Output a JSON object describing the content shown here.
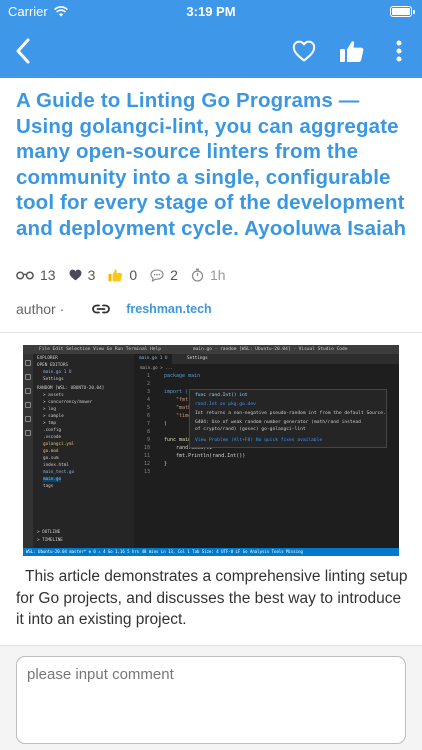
{
  "status_bar": {
    "carrier": "Carrier",
    "time": "3:19 PM"
  },
  "nav": {
    "icons": [
      "chevron-left-icon",
      "heart-outline-icon",
      "thumbs-up-icon",
      "vertical-dots-icon"
    ],
    "background": "#3f97e9"
  },
  "article": {
    "title": "A Guide to Linting Go Programs — Using golangci-lint, you can aggregate many open-source linters from the community into a single, configurable tool for every stage of the development and deployment cycle.   Ayooluwa Isaiah",
    "stats": {
      "views": "13",
      "likes": "3",
      "thumbs": "0",
      "comments": "2",
      "time": "1h"
    },
    "author_label": "author ·",
    "source": "freshman.tech",
    "description": "This article demonstrates a comprehensive linting setup for Go projects, and discusses the best way to introduce it into an existing project.",
    "title_color": "#3b97e0"
  },
  "screenshot": {
    "menu": "File  Edit  Selection  View  Go  Run  Terminal  Help",
    "window_title": "main.go - random [WSL: Ubuntu-20.04] - Visual Studio Code",
    "explorer": [
      "EXPLORER",
      "OPEN EDITORS",
      "main.go  1 U",
      "Settings",
      "RANDOM [WSL: UBUNTU-20.04]",
      "> assets",
      "> concurrency/mower",
      "> log",
      "> sample",
      "> tmp",
      ".config",
      ".vscode",
      "golangci.yml",
      "go.mod",
      "go.sum",
      "index.html",
      "main_test.go",
      "main.go",
      "tags",
      "> OUTLINE",
      "> TIMELINE"
    ],
    "tabs": [
      "main.go  1 U",
      "Settings"
    ],
    "breadcrumb": "main.go > ...",
    "code_lines": [
      "package main",
      "",
      "import (",
      "    \"fmt\"",
      "    \"math/rand\"",
      "    \"time\"",
      ")",
      "",
      "func main() {",
      "    rand.Seed(ti",
      "    fmt.Println(rand.Int())",
      "}",
      ""
    ],
    "popup": [
      "func rand.Int() int",
      "rand.Int on pkg.go.dev",
      "Int returns a non-negative pseudo-random int from the default Source.",
      "G404: Use of weak random number generator (math/rand instead",
      "of crypto/rand) (gosec) go-golangci-lint",
      "View Problem (Alt+F8)    No quick fixes available"
    ],
    "statusbar": "WSL: Ubuntu-20.04   master*   ⊗ 0 ⚠ 4   Go 1.16   5 hrs 48 mins        Ln 13, Col 1   Tab Size: 4   UTF-8   LF   Go   Analysis Tools Missing"
  },
  "comment": {
    "placeholder": "please input comment"
  }
}
